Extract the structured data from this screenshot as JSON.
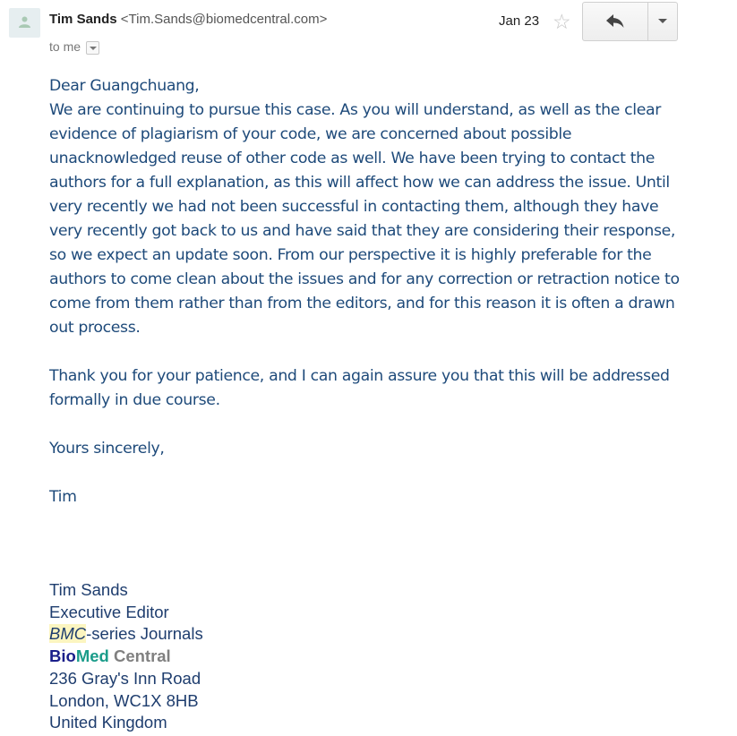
{
  "header": {
    "sender_name": "Tim Sands",
    "sender_email": "<Tim.Sands@biomedcentral.com>",
    "recipient": "to me",
    "date": "Jan 23"
  },
  "icons": {
    "avatar": "person-icon",
    "star": "star-icon",
    "reply": "reply-icon",
    "more": "chevron-down-icon"
  },
  "body": {
    "greeting": "Dear Guangchuang,",
    "paragraph1": "We are continuing to pursue this case. As you will understand, as well as the clear evidence of plagiarism of your code, we are concerned about possible unacknowledged reuse of other code as well. We have been trying to contact the authors for a full explanation, as this will affect how we can address the issue. Until very recently we had not been successful in contacting them, although they have very recently got back to us  and have said that they are considering their response, so we expect an update soon. From our perspective it is highly preferable for the authors to come clean about the issues and for any correction or retraction notice to come from them rather than from the editors, and for this reason it is often a drawn out process.",
    "paragraph2": "Thank you for your patience, and I can again assure you that this will be addressed formally in due course.",
    "closing": "Yours sincerely,",
    "first_name": "Tim"
  },
  "signature": {
    "name": "Tim Sands",
    "title": "Executive Editor",
    "journal_prefix": "BMC",
    "journal_suffix": "-series Journals",
    "org_bio": "Bio",
    "org_med": "Med",
    "org_central": " Central",
    "address1": "236 Gray's Inn Road",
    "address2": "London, WC1X 8HB",
    "country": "United Kingdom"
  },
  "colors": {
    "body_text": "#1e4a7a",
    "bio": "#1a1f8a",
    "med": "#1a9c8a",
    "central": "#808080",
    "highlight": "#fcf5c0"
  }
}
